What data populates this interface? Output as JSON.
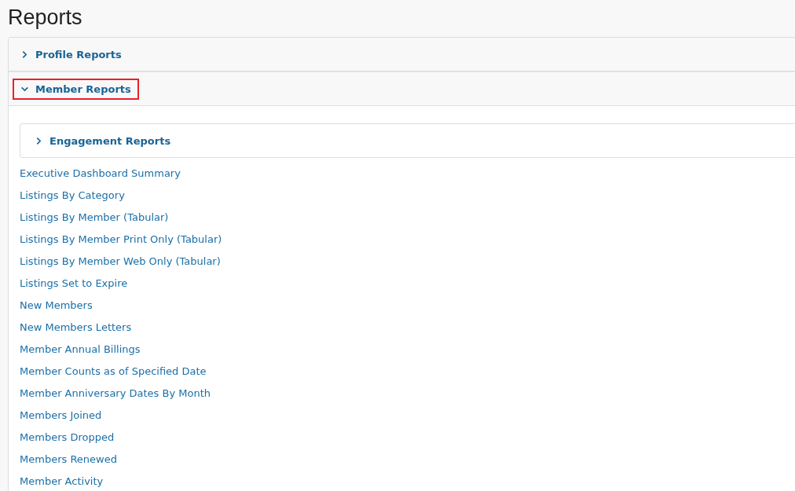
{
  "title": "Reports",
  "sections": [
    {
      "label": "Profile Reports",
      "expanded": false,
      "highlighted": false
    },
    {
      "label": "Member Reports",
      "expanded": true,
      "highlighted": true,
      "subsections": [
        {
          "label": "Engagement Reports",
          "expanded": false
        }
      ],
      "links": [
        "Executive Dashboard Summary",
        "Listings By Category",
        "Listings By Member (Tabular)",
        "Listings By Member Print Only (Tabular)",
        "Listings By Member Web Only (Tabular)",
        "Listings Set to Expire",
        "New Members",
        "New Members Letters",
        "Member Annual Billings",
        "Member Counts as of Specified Date",
        "Member Anniversary Dates By Month",
        "Members Joined",
        "Members Dropped",
        "Members Renewed",
        "Member Activity"
      ]
    }
  ]
}
